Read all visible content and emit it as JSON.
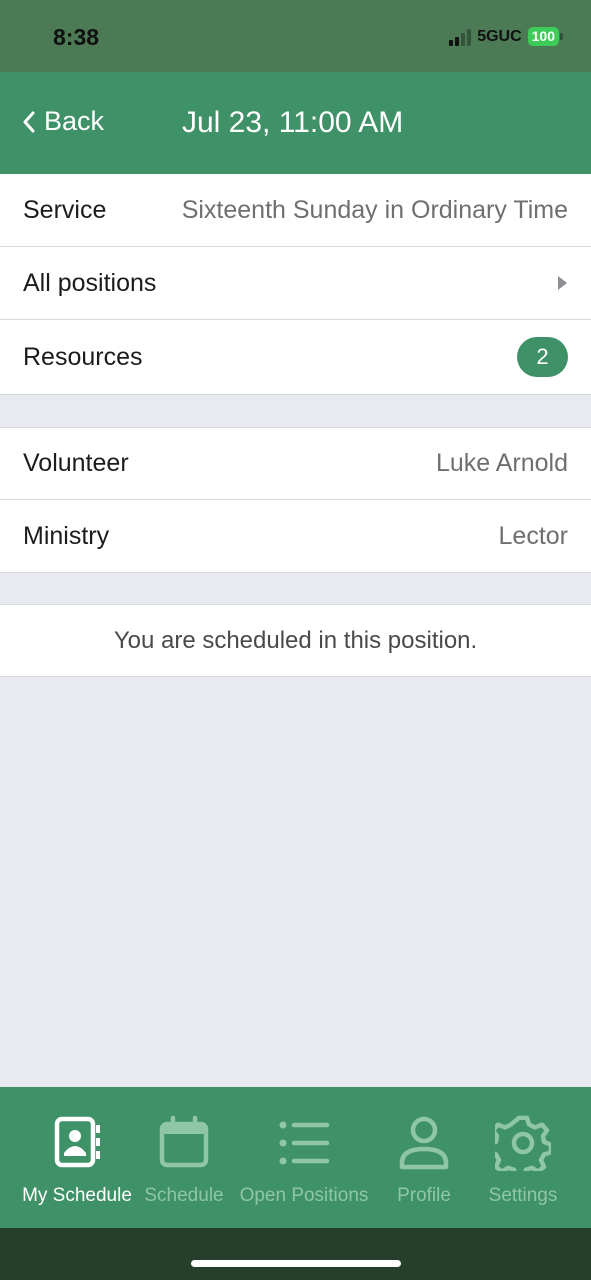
{
  "status_bar": {
    "time": "8:38",
    "network": "5GUC",
    "battery": "100"
  },
  "nav": {
    "back_label": "Back",
    "title": "Jul 23, 11:00 AM"
  },
  "details": {
    "service_label": "Service",
    "service_value": "Sixteenth Sunday in Ordinary Time",
    "positions_label": "All positions",
    "resources_label": "Resources",
    "resources_count": "2"
  },
  "assignment": {
    "volunteer_label": "Volunteer",
    "volunteer_value": "Luke Arnold",
    "ministry_label": "Ministry",
    "ministry_value": "Lector"
  },
  "message": "You are scheduled in this position.",
  "tabs": [
    {
      "label": "My Schedule",
      "icon": "contact-book-icon",
      "active": true
    },
    {
      "label": "Schedule",
      "icon": "calendar-icon",
      "active": false
    },
    {
      "label": "Open Positions",
      "icon": "list-icon",
      "active": false
    },
    {
      "label": "Profile",
      "icon": "person-icon",
      "active": false
    },
    {
      "label": "Settings",
      "icon": "gear-icon",
      "active": false
    }
  ],
  "colors": {
    "brand_green": "#3f9267",
    "background": "#e8eaf2",
    "inactive_tab": "#8fc6a6"
  }
}
